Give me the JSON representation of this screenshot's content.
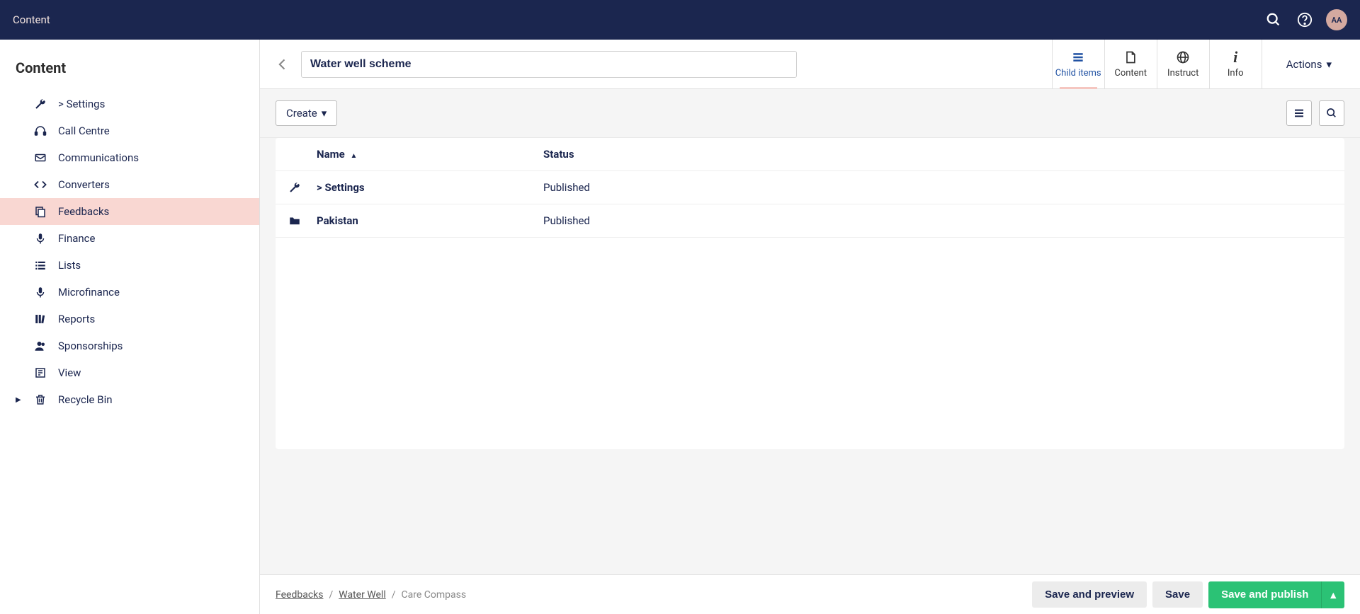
{
  "topbar": {
    "title": "Content",
    "avatar_initials": "AA"
  },
  "sidebar": {
    "title": "Content",
    "items": [
      {
        "icon": "wrench",
        "label": "> Settings",
        "active": false
      },
      {
        "icon": "headset",
        "label": "Call Centre",
        "active": false
      },
      {
        "icon": "envelope",
        "label": "Communications",
        "active": false
      },
      {
        "icon": "code",
        "label": "Converters",
        "active": false
      },
      {
        "icon": "copy",
        "label": "Feedbacks",
        "active": true
      },
      {
        "icon": "mic",
        "label": "Finance",
        "active": false
      },
      {
        "icon": "list",
        "label": "Lists",
        "active": false
      },
      {
        "icon": "mic",
        "label": "Microfinance",
        "active": false
      },
      {
        "icon": "books",
        "label": "Reports",
        "active": false
      },
      {
        "icon": "user",
        "label": "Sponsorships",
        "active": false
      },
      {
        "icon": "news",
        "label": "View",
        "active": false
      },
      {
        "icon": "trash",
        "label": "Recycle Bin",
        "active": false,
        "has_caret": true
      }
    ]
  },
  "editor": {
    "title_value": "Water well scheme",
    "tabs": [
      {
        "label": "Child items",
        "icon": "list",
        "active": true
      },
      {
        "label": "Content",
        "icon": "file",
        "active": false
      },
      {
        "label": "Instruct",
        "icon": "globe",
        "active": false
      },
      {
        "label": "Info",
        "icon": "info",
        "active": false
      }
    ],
    "actions_label": "Actions"
  },
  "toolbar": {
    "create_label": "Create"
  },
  "table": {
    "headers": {
      "name": "Name",
      "status": "Status"
    },
    "sort_dir": "asc",
    "rows": [
      {
        "icon": "wrench",
        "name": "> Settings",
        "status": "Published"
      },
      {
        "icon": "folder",
        "name": "Pakistan",
        "status": "Published"
      }
    ]
  },
  "breadcrumb": [
    {
      "label": "Feedbacks",
      "link": true
    },
    {
      "label": "Water Well",
      "link": true
    },
    {
      "label": "Care Compass",
      "link": false
    }
  ],
  "footer": {
    "save_preview": "Save and preview",
    "save": "Save",
    "save_publish": "Save and publish"
  }
}
